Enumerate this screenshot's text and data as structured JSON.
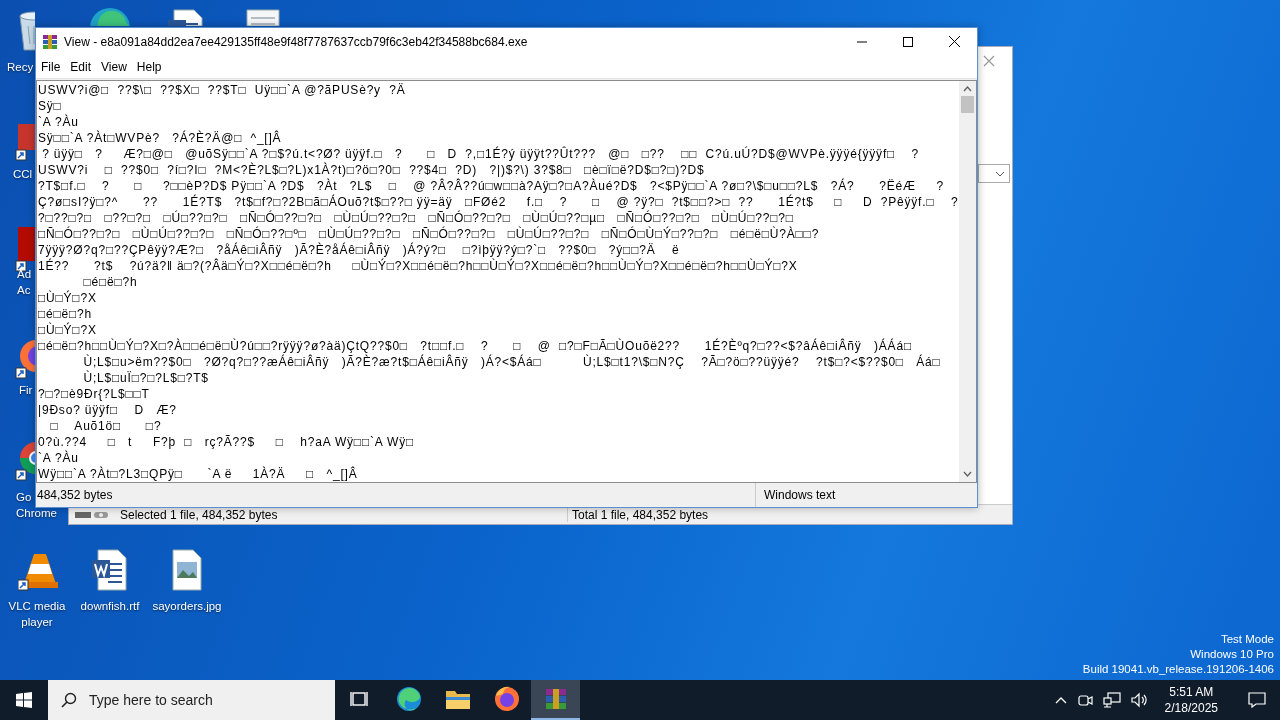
{
  "desktop": {
    "icons": [
      {
        "kind": "recycle-bin",
        "lines": [
          "Recy"
        ]
      },
      {
        "kind": "edge"
      },
      {
        "kind": "word-doc"
      },
      {
        "kind": "text-file"
      },
      {
        "kind": "ccleaner",
        "lines": [
          "CCl"
        ]
      },
      {
        "kind": "acrobat",
        "lines": [
          "Ad",
          "Ac"
        ]
      },
      {
        "kind": "firefox",
        "lines": [
          "Fir"
        ]
      },
      {
        "kind": "chrome",
        "lines": [
          "Go",
          "Chrome"
        ]
      },
      {
        "kind": "vlc",
        "lines": [
          "VLC media",
          "player"
        ]
      },
      {
        "kind": "word-doc",
        "lines": [
          "downfish.rtf"
        ]
      },
      {
        "kind": "image-file",
        "lines": [
          "sayorders.jpg"
        ]
      }
    ],
    "system_info": [
      "Test Mode",
      "Windows 10 Pro",
      "Build 19041.vb_release.191206-1406"
    ]
  },
  "background_window": {
    "status_bar": [
      "Selected 1 file, 484,352 bytes",
      "Total 1 file, 484,352 bytes"
    ]
  },
  "viewer": {
    "title": "View - e8a091a84dd2ea7ee429135ff48e9f48f7787637ccb79f6c3eb42f34588bc684.exe",
    "menu": [
      "File",
      "Edit",
      "View",
      "Help"
    ],
    "lines": [
      "USWV?i@□  ??$\\□  ??$X□  ??$T□  Uÿ□□`A @?ãPUSè?y  ?Ä",
      "Sÿ□",
      "`A ?Àu",
      "Sÿ□□`A ?Àt□WVPè?   ?Á?È?Ä@□  ^_[]Â",
      " ? üÿÿ□   ?     Æ?□@□   @uõSÿ□□`A ?□$?ú.t<?Ø? üÿÿf.□   ?      □   D  ?,□1É?ý üÿÿt??Ût???   @□   □??    □□  C?ú.uÚ?D$@WVPè.ÿÿÿé{ÿÿÿf□    ?",
      "USWV?i    □  ??$0□  ?í□?I□  ?M<?È?L$□?L)x1À?t)□?ö□?0□  ??$4□  ?D)   ?|)$?\\) 3?$8□   □è□ï□ë?D$□?□)?D$",
      "?T$□f.□    ?      □     ?□□èP?D$ Pÿ□□`A ?D$   ?Àt   ?L$    □    @ ?Â?Â??ú□w□□à?Aÿ□?□A?Àué?D$   ?<$Pÿ□□`A ?ø□?\\$□u□□?L$   ?Á?      ?ËéÆ     ?",
      "Ç?ø□sI?ÿ□?^      ??      1É?T$   ?t$□f?□?2B□ã□ÁOuõ?t$□??□ ÿÿ=äÿ   □FØé2     f.□    ?      □    @ ?ÿ?□  ?t$□□?>□  ??      1É?t$     □     D  ?Pêÿÿf.□    ?",
      "?□??□?□   □??□?□   □Ú□??□?□   □Ñ□Ó□??□?□   □Ù□Ú□??□?□   □Ñ□Ó□??□?□   □Ù□Ú□??□µ□   □Ñ□Ó□??□?□   □Ù□Ú□??□?□",
      "□Ñ□Ó□??□?□   □Ù□Ú□??□?□   □Ñ□Ó□??□º□   □Ù□Ú□??□?□   □Ñ□Ó□??□?□   □Ù□Ú□??□?□   □Ñ□Ó□Ù□Ý□??□?□   □é□ë□Ù?À□□?",
      "7ÿÿÿ?Ø?q?□??ÇPêÿÿ?Æ?□   ?åÁê□iÂñÿ   )Ã?È?åÁê□iÂñÿ   )Á?ý?□    □?ìþÿÿ?ý□?`□   ??$0□   ?ý□□?Ä    ë",
      "1É??      ?t$    ?ú?ä?‖ ä□?(?Âä□Ý□?X□□é□ë□?h     □Ù□Ý□?X□□é□ë□?h□□Ù□Ý□?X□□é□ë□?h□□Ù□Ý□?X□□é□ë□?h□□Ù□Ý□?X",
      "           □é□ë□?h",
      "□Ù□Ý□?X",
      "□é□ë□?h",
      "□Ù□Ý□?X",
      "□é□ë□?h□□Ù□Ý□?X□?À□□é□ë□Ù?ú□□?rÿÿÿ?ø?àä)ÇtQ??$0□   ?t□□f.□    ?      □    @  □?□F□Ã□ÙOuõë2??      1É?Èºq?□??<$?âÁê□iÂñÿ   )ÁÁá□",
      "           Ù;L$□u>ëm??$0□   ?Ø?q?□??æÁê□iÂñÿ   )Ã?È?æ?t$□Áê□iÂñÿ   )Á?<$Áá□          Ù;L$□t1?\\$□N?Ç    ?Ã□?ö□??üÿÿé?    ?t$□?<$??$0□   Áá□",
      "           Ù;L$□uÏ□?□?L$□?T$",
      "?□?□è9Ðr{?L$□□T",
      "|9Ðso? üÿÿf□    D   Æ?",
      "   □    Auõ1ö□      □?",
      "0?ù.??4     □   t     F?þ  □   rç?Ã??$     □    h?aA Wÿ□□`A Wÿ□",
      "`A ?Àu",
      "Wÿ□□`A ?Àt□?L3□QPÿ□      `A ë     1À?Ä     □   ^_[]Â"
    ],
    "status_bar": [
      "484,352 bytes",
      "Windows text"
    ]
  },
  "taskbar": {
    "search": {
      "placeholder": "Type here to search"
    },
    "apps": [
      {
        "kind": "task-view",
        "selected": false
      },
      {
        "kind": "edge",
        "selected": false
      },
      {
        "kind": "folder",
        "selected": false
      },
      {
        "kind": "firefox",
        "selected": false
      },
      {
        "kind": "archive",
        "selected": true
      }
    ],
    "clock": {
      "time": "5:51 AM",
      "date": "2/18/2025"
    }
  }
}
